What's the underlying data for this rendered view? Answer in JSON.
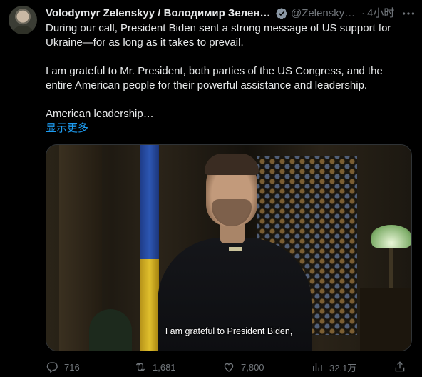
{
  "author": {
    "name": "Volodymyr Zelenskyy / Володимир Зеленський",
    "handle": "@ZelenskyyUa",
    "time": "4小时"
  },
  "body": {
    "paragraphs": [
      "During our call, President Biden sent a strong message of US support for Ukraine—for as long as it takes to prevail.",
      "I am grateful to Mr. President, both parties of the US Congress, and the entire American people for their powerful assistance and leadership.",
      "American leadership…"
    ],
    "show_more": "显示更多"
  },
  "media": {
    "caption": "I am grateful to President Biden,"
  },
  "stats": {
    "replies": "716",
    "retweets": "1,681",
    "likes": "7,800",
    "views": "32.1万"
  },
  "colors": {
    "accent": "#1d9bf0",
    "muted": "#71767b",
    "text": "#e7e9ea",
    "background": "#000000"
  },
  "icons": [
    "verified-badge-icon",
    "more-icon",
    "reply-icon",
    "retweet-icon",
    "like-icon",
    "views-icon",
    "share-icon"
  ]
}
